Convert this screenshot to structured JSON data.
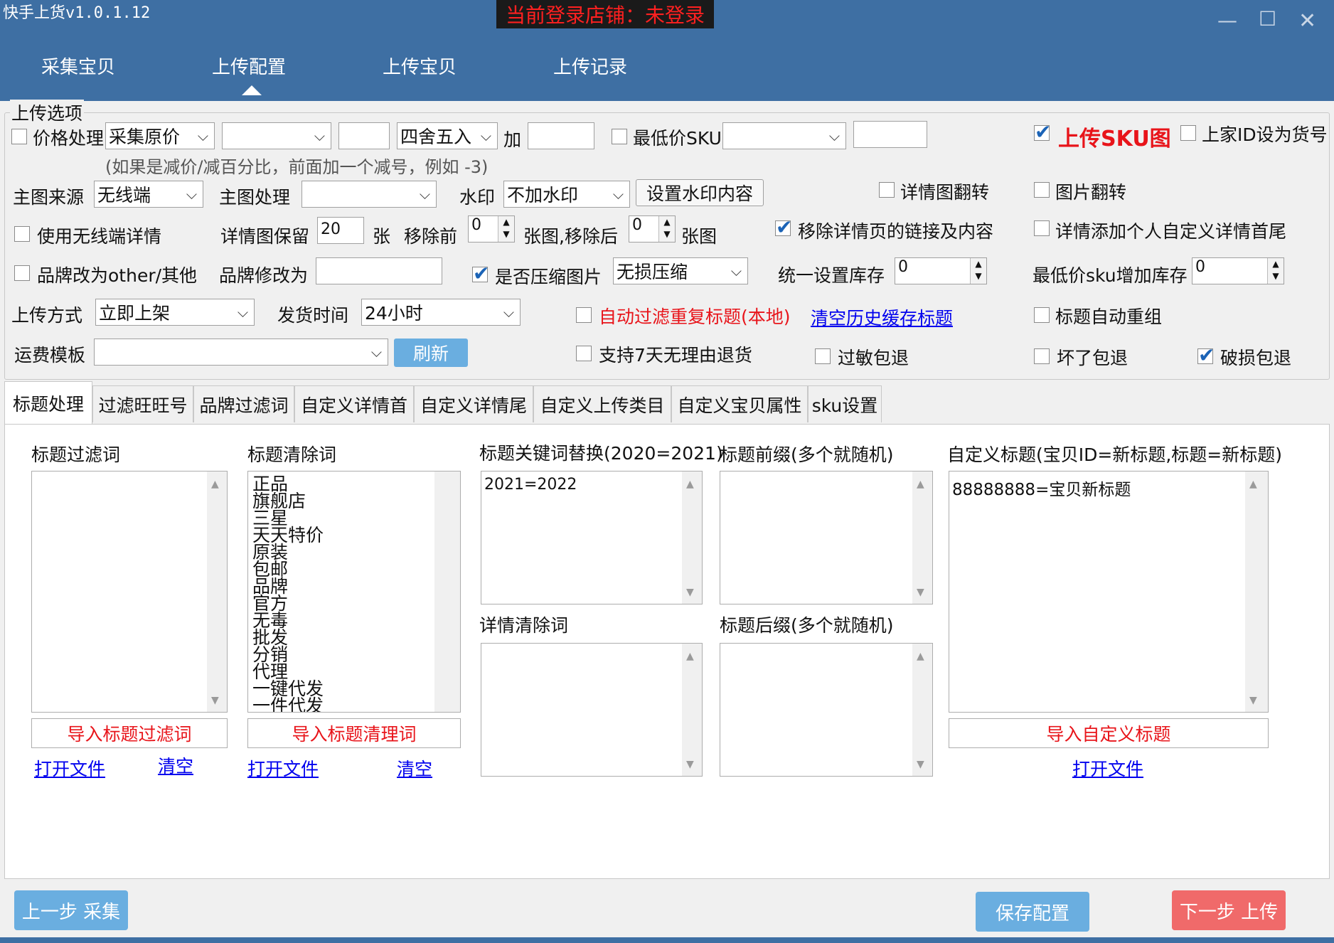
{
  "app": {
    "title": "快手上货v1.0.1.12",
    "login_status": "当前登录店铺：未登录"
  },
  "window_controls": {
    "minimize": "—",
    "maximize": "☐",
    "close": "✕"
  },
  "nav": {
    "items": [
      "采集宝贝",
      "上传配置",
      "上传宝贝",
      "上传记录"
    ],
    "active": "上传配置"
  },
  "options": {
    "legend": "上传选项",
    "price_process": {
      "label": "价格处理",
      "source": "采集原价",
      "mode": "",
      "value": "",
      "rounding": "四舍五入",
      "add_label": "加",
      "add_value": "",
      "hint": "(如果是减价/减百分比，前面加一个减号，例如 -3)"
    },
    "lowest_sku": {
      "label": "最低价SKU",
      "select": "",
      "value": ""
    },
    "upload_sku_image": {
      "label": "上传SKU图",
      "checked": true
    },
    "id_as_sku": {
      "label": "上家ID设为货号"
    },
    "main_image_source": {
      "label": "主图来源",
      "value": "无线端"
    },
    "main_image_process": {
      "label": "主图处理",
      "value": ""
    },
    "watermark": {
      "label": "水印",
      "value": "不加水印",
      "button": "设置水印内容"
    },
    "detail_flip": {
      "label": "详情图翻转"
    },
    "image_flip": {
      "label": "图片翻转"
    },
    "use_wireless_detail": {
      "label": "使用无线端详情"
    },
    "detail_keep": {
      "label": "详情图保留",
      "value": "20",
      "unit": "张",
      "remove_before_label": "移除前",
      "remove_before": "0",
      "remove_after_label": "张图,移除后",
      "remove_after": "0",
      "unit2": "张图"
    },
    "remove_links": {
      "label": "移除详情页的链接及内容",
      "checked": true
    },
    "detail_custom": {
      "label": "详情添加个人自定义详情首尾"
    },
    "brand_other": {
      "label": "品牌改为other/其他"
    },
    "brand_change": {
      "label": "品牌修改为",
      "value": ""
    },
    "compress": {
      "label": "是否压缩图片",
      "checked": true,
      "value": "无损压缩"
    },
    "stock": {
      "label": "统一设置库存",
      "value": "0"
    },
    "lowest_stock": {
      "label": "最低价sku增加库存",
      "value": "0"
    },
    "upload_method": {
      "label": "上传方式",
      "value": "立即上架"
    },
    "ship_time": {
      "label": "发货时间",
      "value": "24小时"
    },
    "auto_filter": {
      "label": "自动过滤重复标题(本地)"
    },
    "clear_cache": {
      "label": "清空历史缓存标题"
    },
    "title_regroup": {
      "label": "标题自动重组"
    },
    "freight": {
      "label": "运费模板",
      "value": "",
      "refresh": "刷新"
    },
    "seven_day": {
      "label": "支持7天无理由退货"
    },
    "allergy": {
      "label": "过敏包退"
    },
    "broken": {
      "label": "坏了包退"
    },
    "damaged": {
      "label": "破损包退",
      "checked": true
    }
  },
  "tabs": [
    "标题处理",
    "过滤旺旺号",
    "品牌过滤词",
    "自定义详情首",
    "自定义详情尾",
    "自定义上传类目",
    "自定义宝贝属性",
    "sku设置"
  ],
  "title_panel": {
    "filter": {
      "label": "标题过滤词",
      "import": "导入标题过滤词",
      "open": "打开文件",
      "clear": "清空"
    },
    "clean": {
      "label": "标题清除词",
      "words": [
        "正品",
        "旗舰店",
        "三星",
        "天天特价",
        "原装",
        "包邮",
        "品牌",
        "官方",
        "无毒",
        "批发",
        "分销",
        "代理",
        "一键代发",
        "一件代发"
      ],
      "import": "导入标题清理词",
      "open": "打开文件",
      "clear": "清空"
    },
    "replace": {
      "label": "标题关键词替换(2020=2021)",
      "value": "2021=2022"
    },
    "detail_clear": {
      "label": "详情清除词"
    },
    "prefix": {
      "label": "标题前缀(多个就随机)"
    },
    "suffix": {
      "label": "标题后缀(多个就随机)"
    },
    "custom": {
      "label": "自定义标题(宝贝ID=新标题,标题=新标题)",
      "value": "88888888=宝贝新标题",
      "import": "导入自定义标题",
      "open": "打开文件"
    }
  },
  "footer": {
    "prev": "上一步 采集",
    "save": "保存配置",
    "next": "下一步 上传"
  },
  "colors": {
    "titlebar": "#3e6fa3",
    "accent_blue": "#6aaee0",
    "next_red": "#f06a6a",
    "red_text": "#e8141a"
  }
}
